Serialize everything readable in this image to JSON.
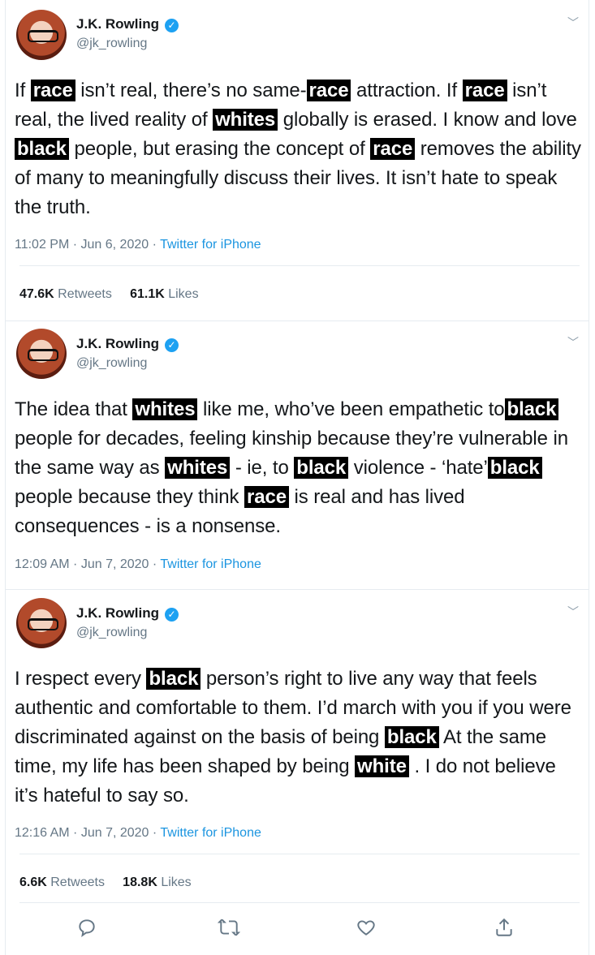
{
  "tweets": [
    {
      "name": "J.K. Rowling",
      "handle": "@jk_rowling",
      "time": "11:02 PM · Jun 6, 2020 · ",
      "source": "Twitter for iPhone",
      "text": {
        "a": "If ",
        "t1": "race",
        "b": " isn’t real, there’s no same-",
        "t2": "race",
        "c": " attraction. If ",
        "t3": "race",
        "d": " isn’t real, the lived reality of ",
        "t4": "whites",
        "e": " globally is erased. I know and love ",
        "t5": "black",
        "f": " people, but erasing the concept of ",
        "t6": "race",
        "g": " removes the ability of many to meaningfully discuss their lives. It isn’t hate to speak the truth."
      },
      "retweets_count": "47.6K",
      "retweets_label": " Retweets",
      "likes_count": "61.1K",
      "likes_label": " Likes"
    },
    {
      "name": "J.K. Rowling",
      "handle": "@jk_rowling",
      "time": "12:09 AM · Jun 7, 2020 · ",
      "source": "Twitter for iPhone",
      "text": {
        "a": "The idea that ",
        "t1": "whites",
        "b": " like me, who’ve been empathetic to",
        "t2": "black",
        "c": " people for decades, feeling kinship because they’re vulnerable in the same way as ",
        "t3": "whites",
        "d": " - ie, to ",
        "t4": "black",
        "e": " violence - ‘hate’",
        "t5": "black",
        "f": " people because they think ",
        "t6": "race",
        "g": " is real and has lived consequences - is a nonsense."
      }
    },
    {
      "name": "J.K. Rowling",
      "handle": "@jk_rowling",
      "time": "12:16 AM · Jun 7, 2020 · ",
      "source": "Twitter for iPhone",
      "text": {
        "a": "I respect every ",
        "t1": "black",
        "b": " person’s right to live any way that feels authentic and comfortable to them. I’d march with you if you were discriminated against on the basis of being ",
        "t2": "black",
        "c": " At the same time, my life has been shaped by being ",
        "t3": "white",
        "d": " . I do not believe it’s hateful to say so."
      },
      "retweets_count": "6.6K",
      "retweets_label": " Retweets",
      "likes_count": "18.8K",
      "likes_label": " Likes"
    }
  ],
  "icons": {
    "verified": "verified-badge-icon",
    "caret": "chevron-down-icon",
    "reply": "reply-icon",
    "retweet": "retweet-icon",
    "like": "heart-icon",
    "share": "share-icon"
  },
  "colors": {
    "accent": "#1da1f2",
    "link": "#1b95e0",
    "muted": "#657786",
    "text": "#14171a",
    "divider": "#e6ecf0"
  }
}
